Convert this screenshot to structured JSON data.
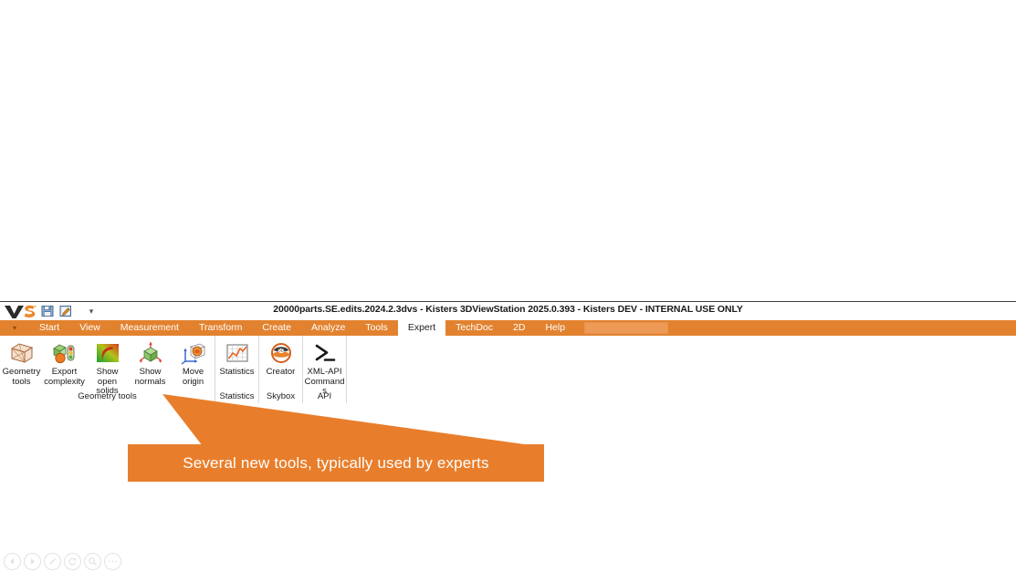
{
  "window": {
    "title": "20000parts.SE.edits.2024.2.3dvs - Kisters 3DViewStation 2025.0.393 - Kisters DEV - INTERNAL USE ONLY",
    "logo_text": "VS",
    "accent_color": "#e2822f",
    "callout_color": "#e87e2b"
  },
  "quick_access": {
    "save_tooltip": "Save",
    "open_tooltip": "Open",
    "customize_caret": "▾"
  },
  "menu": {
    "caret": "▾",
    "tabs": [
      {
        "label": "Start",
        "active": false
      },
      {
        "label": "View",
        "active": false
      },
      {
        "label": "Measurement",
        "active": false
      },
      {
        "label": "Transform",
        "active": false
      },
      {
        "label": "Create",
        "active": false
      },
      {
        "label": "Analyze",
        "active": false
      },
      {
        "label": "Tools",
        "active": false
      },
      {
        "label": "Expert",
        "active": true
      },
      {
        "label": "TechDoc",
        "active": false
      },
      {
        "label": "2D",
        "active": false
      },
      {
        "label": "Help",
        "active": false
      }
    ],
    "search_placeholder": ""
  },
  "ribbon": {
    "groups": [
      {
        "label": "Geometry tools",
        "buttons": [
          {
            "label": "Geometry tools",
            "icon": "wireframe-cube-icon"
          },
          {
            "label": "Export complexity",
            "icon": "export-complexity-icon"
          },
          {
            "label": "Show open solids",
            "icon": "open-solids-gradient-icon"
          },
          {
            "label": "Show normals",
            "icon": "normals-cube-icon"
          },
          {
            "label": "Move origin",
            "icon": "move-origin-axis-icon"
          }
        ]
      },
      {
        "label": "Statistics",
        "buttons": [
          {
            "label": "Statistics",
            "icon": "statistics-chart-icon"
          }
        ]
      },
      {
        "label": "Skybox",
        "buttons": [
          {
            "label": "Creator",
            "icon": "skybox-creator-icon"
          }
        ]
      },
      {
        "label": "API",
        "buttons": [
          {
            "label": "XML-API Commands",
            "icon": "console-prompt-icon"
          }
        ]
      }
    ]
  },
  "callout": {
    "text": "Several new tools, typically used by experts"
  },
  "bottom_controls": [
    {
      "name": "previous-button",
      "icon": "back-icon"
    },
    {
      "name": "play-button",
      "icon": "play-icon"
    },
    {
      "name": "pen-button",
      "icon": "pen-icon"
    },
    {
      "name": "refresh-button",
      "icon": "refresh-icon"
    },
    {
      "name": "zoom-button",
      "icon": "magnifier-icon"
    },
    {
      "name": "more-button",
      "icon": "ellipsis-icon"
    }
  ]
}
